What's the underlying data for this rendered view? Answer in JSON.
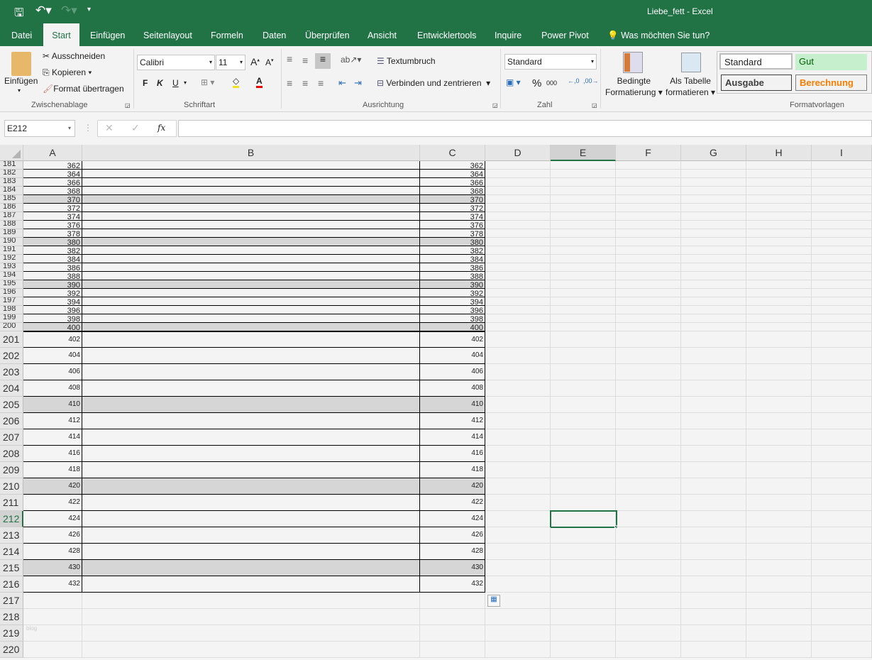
{
  "window": {
    "title": "Liebe_fett  -  Excel"
  },
  "tabs": [
    "Datei",
    "Start",
    "Einfügen",
    "Seitenlayout",
    "Formeln",
    "Daten",
    "Überprüfen",
    "Ansicht",
    "Entwicklertools",
    "Inquire",
    "Power Pivot"
  ],
  "tell_me": "Was möchten Sie tun?",
  "clipboard": {
    "paste": "Einfügen",
    "cut": "Ausschneiden",
    "copy": "Kopieren",
    "format_painter": "Format übertragen",
    "label": "Zwischenablage"
  },
  "font": {
    "name": "Calibri",
    "size": "11",
    "bold": "F",
    "italic": "K",
    "underline": "U",
    "label": "Schriftart"
  },
  "alignment": {
    "wrap": "Textumbruch",
    "merge": "Verbinden und zentrieren",
    "label": "Ausrichtung"
  },
  "number": {
    "format": "Standard",
    "percent": "%",
    "thousands": "000",
    "label": "Zahl"
  },
  "styles": {
    "conditional": [
      "Bedingte",
      "Formatierung"
    ],
    "as_table": [
      "Als Tabelle",
      "formatieren"
    ],
    "cells": [
      "Standard",
      "Gut",
      "Ausgabe",
      "Berechnung"
    ],
    "label": "Formatvorlagen"
  },
  "formula_bar": {
    "name_box": "E212",
    "fx": "fx",
    "value": ""
  },
  "columns": [
    "A",
    "B",
    "C",
    "D",
    "E",
    "F",
    "G",
    "H",
    "I"
  ],
  "rows": [
    {
      "n": "181",
      "a": "362",
      "c": "362"
    },
    {
      "n": "182",
      "a": "364",
      "c": "364"
    },
    {
      "n": "183",
      "a": "366",
      "c": "366"
    },
    {
      "n": "184",
      "a": "368",
      "c": "368"
    },
    {
      "n": "185",
      "a": "370",
      "c": "370",
      "shade": true
    },
    {
      "n": "186",
      "a": "372",
      "c": "372"
    },
    {
      "n": "187",
      "a": "374",
      "c": "374"
    },
    {
      "n": "188",
      "a": "376",
      "c": "376"
    },
    {
      "n": "189",
      "a": "378",
      "c": "378"
    },
    {
      "n": "190",
      "a": "380",
      "c": "380",
      "shade": true
    },
    {
      "n": "191",
      "a": "382",
      "c": "382"
    },
    {
      "n": "192",
      "a": "384",
      "c": "384"
    },
    {
      "n": "193",
      "a": "386",
      "c": "386"
    },
    {
      "n": "194",
      "a": "388",
      "c": "388"
    },
    {
      "n": "195",
      "a": "390",
      "c": "390",
      "shade": true
    },
    {
      "n": "196",
      "a": "392",
      "c": "392"
    },
    {
      "n": "197",
      "a": "394",
      "c": "394"
    },
    {
      "n": "198",
      "a": "396",
      "c": "396"
    },
    {
      "n": "199",
      "a": "398",
      "c": "398"
    },
    {
      "n": "200",
      "a": "400",
      "c": "400",
      "shade": true
    },
    {
      "n": "201",
      "a": "402",
      "c": "402"
    },
    {
      "n": "202",
      "a": "404",
      "c": "404"
    },
    {
      "n": "203",
      "a": "406",
      "c": "406"
    },
    {
      "n": "204",
      "a": "408",
      "c": "408"
    },
    {
      "n": "205",
      "a": "410",
      "c": "410",
      "shade": true
    },
    {
      "n": "206",
      "a": "412",
      "c": "412"
    },
    {
      "n": "207",
      "a": "414",
      "c": "414"
    },
    {
      "n": "208",
      "a": "416",
      "c": "416"
    },
    {
      "n": "209",
      "a": "418",
      "c": "418"
    },
    {
      "n": "210",
      "a": "420",
      "c": "420",
      "shade": true
    },
    {
      "n": "211",
      "a": "422",
      "c": "422"
    },
    {
      "n": "212",
      "a": "424",
      "c": "424"
    },
    {
      "n": "213",
      "a": "426",
      "c": "426"
    },
    {
      "n": "214",
      "a": "428",
      "c": "428"
    },
    {
      "n": "215",
      "a": "430",
      "c": "430",
      "shade": true
    },
    {
      "n": "216",
      "a": "432",
      "c": "432"
    },
    {
      "n": "217"
    },
    {
      "n": "218"
    },
    {
      "n": "219",
      "a_note": "blog"
    },
    {
      "n": "220"
    }
  ],
  "colors": {
    "brand": "#217346",
    "shade": "#d6d6d6",
    "selection": "#217346"
  }
}
